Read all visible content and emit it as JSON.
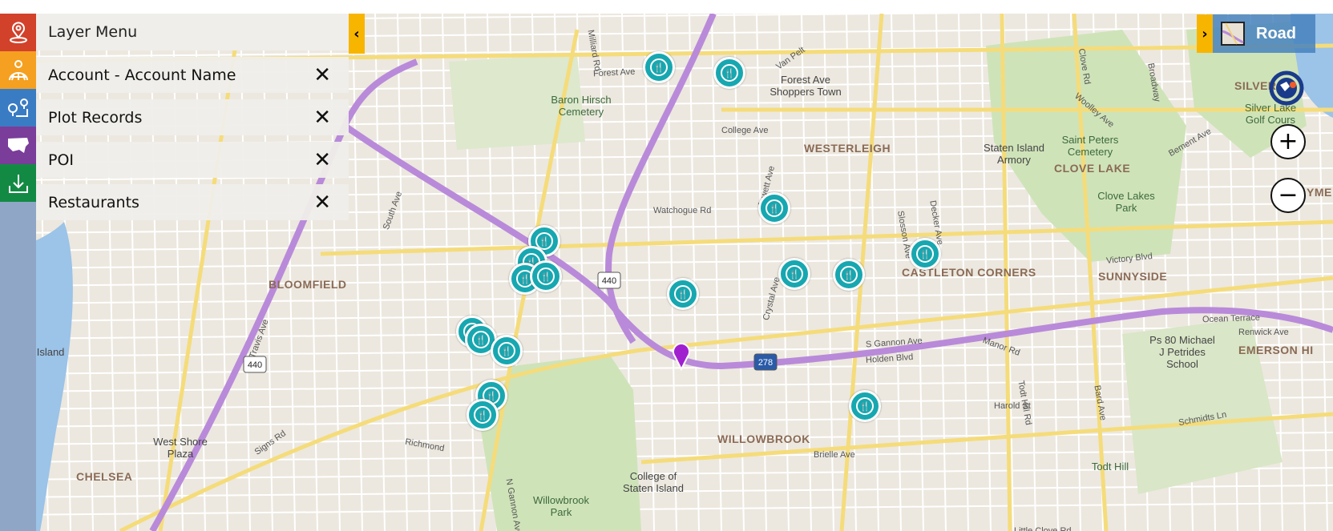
{
  "layer_menu": {
    "title": "Layer Menu",
    "layers": [
      {
        "label": "Account - Account Name"
      },
      {
        "label": "Plot Records"
      },
      {
        "label": "POI"
      },
      {
        "label": "Restaurants"
      }
    ]
  },
  "sidebar": {
    "items": [
      {
        "icon": "map-pin-icon",
        "color": "#d2412a"
      },
      {
        "icon": "globe-pin-icon",
        "color": "#f5a020"
      },
      {
        "icon": "route-icon",
        "color": "#3a7cc4"
      },
      {
        "icon": "us-map-icon",
        "color": "#7a3d9a"
      },
      {
        "icon": "download-icon",
        "color": "#138a44"
      }
    ]
  },
  "map_controls": {
    "map_type": "Road",
    "zoom_in": "+",
    "zoom_out": "−"
  },
  "colors": {
    "marker": "#17a7b0",
    "pin": "#a020d0",
    "highway": "#b98ad9",
    "major_road": "#f5dc7a",
    "water": "#9cc3e8",
    "park": "#cfe3b9"
  },
  "map_labels": {
    "neighborhoods": [
      "BLOOMFIELD",
      "CHELSEA",
      "WESTERLEIGH",
      "CASTLETON CORNERS",
      "SUNNYSIDE",
      "WILLOWBROOK",
      "CLOVE LAKE",
      "EMERSON HI",
      "SILVER",
      "YME"
    ],
    "places": [
      "Baron Hirsch Cemetery",
      "Forest Ave Shoppers Town",
      "Staten Island Armory",
      "Saint Peters Cemetery",
      "Clove Lakes Park",
      "Silver Lake Golf Cours",
      "Pralls Island",
      "West Shore Plaza",
      "College of Staten Island",
      "Willowbrook Park",
      "Ps 80 Michael J Petrides School",
      "Todt Hill"
    ],
    "streets": [
      "Forest Ave",
      "College Ave",
      "Watchogue Rd",
      "Victory Blvd",
      "South Ave",
      "Travis Ave",
      "Signs Rd",
      "Richmond",
      "N Gannon Ave",
      "S Gannon Ave",
      "Holden Blvd",
      "Harold St",
      "Brielle Ave",
      "Little Clove Rd",
      "Ocean Terrace",
      "Schmidts Ln",
      "Manor Rd",
      "Todt Hill Rd",
      "Bard Ave",
      "Bement Ave",
      "Broadway",
      "Clove Rd",
      "Woolley Ave",
      "Crystal Ave",
      "Jewett Ave",
      "Slosson Ave",
      "Decker Ave",
      "Van Pelt",
      "Milliard Rd",
      "Renwick Ave"
    ],
    "shields": [
      "440",
      "440",
      "278"
    ]
  }
}
